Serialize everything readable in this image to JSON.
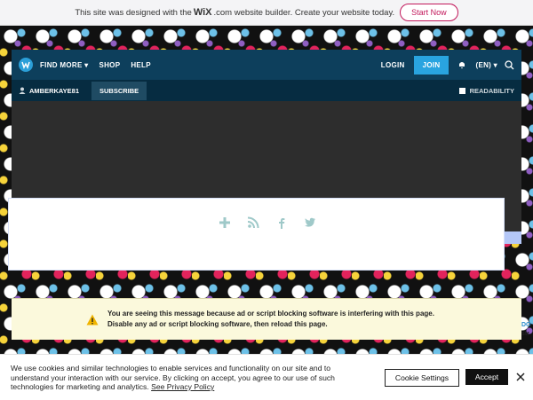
{
  "wix_banner": {
    "text_before": "This site was designed with the",
    "logo": "WiX",
    "text_after": ".com website builder. Create your website today.",
    "cta": "Start Now"
  },
  "nav": {
    "logo_icon": "wattpad-w-icon",
    "find_more": "FIND MORE",
    "shop": "SHOP",
    "help": "HELP",
    "login": "LOGIN",
    "join": "JOIN",
    "language": "(EN)"
  },
  "subnav": {
    "user": "AMBERKAYE81",
    "subscribe": "SUBSCRIBE",
    "readability": "READABILITY"
  },
  "social_icons": [
    "plus-icon",
    "rss-icon",
    "facebook-icon",
    "twitter-icon"
  ],
  "adblock_notice": {
    "line1": "You are seeing this message because ad or script blocking software is interfering with this page.",
    "line2": "Disable any ad or script blocking software, then reload this page."
  },
  "right_edge_text": {
    "line1": "DO",
    "line2": "str"
  },
  "cookie_bar": {
    "text": "We use cookies and similar technologies to enable services and functionality on our site and to understand your interaction with our service. By clicking on accept, you agree to our use of such technologies for marketing and analytics.",
    "link": "See Privacy Policy",
    "settings_button": "Cookie Settings",
    "accept_button": "Accept"
  },
  "colors": {
    "nav_bg": "#0d3f5c",
    "subnav_bg": "#062c41",
    "join_bg": "#29a4e0",
    "accent_pink": "#c2185b",
    "notice_bg": "#fbf9dc"
  }
}
